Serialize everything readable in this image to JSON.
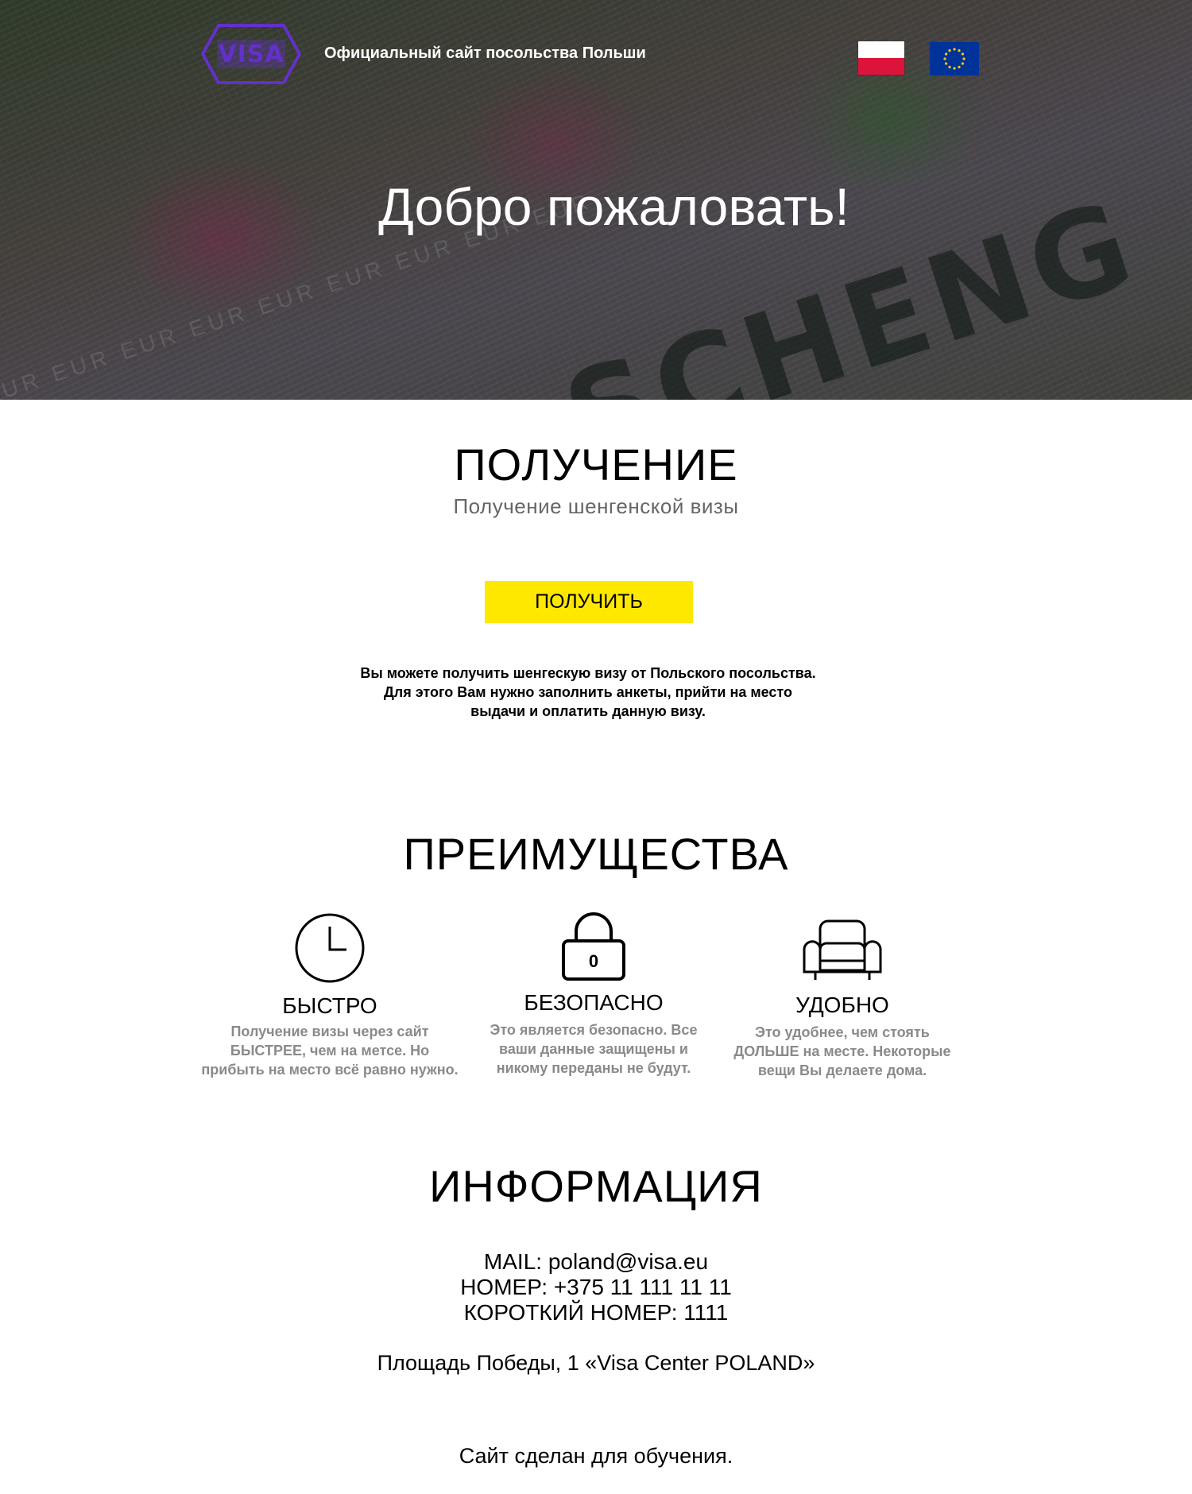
{
  "header": {
    "logo_text": "VISA",
    "site_title": "Официальный сайт посольства Польши",
    "lang_flags": [
      {
        "name": "poland-flag",
        "colors": [
          "#ffffff",
          "#dc143c"
        ]
      },
      {
        "name": "eu-flag",
        "colors": [
          "#003399",
          "#ffcc00"
        ]
      }
    ]
  },
  "hero": {
    "welcome": "Добро пожаловать!",
    "watermark_text": "SCHENG",
    "eur_pattern": "EUR EUR EUR EUR EUR EUR EUR EUR EUR"
  },
  "obtain": {
    "title": "ПОЛУЧЕНИЕ",
    "subtitle": "Получение шенгенской визы",
    "button_label": "ПОЛУЧИТЬ",
    "button_color": "#ffe800",
    "description_lines": [
      "Вы можете получить шенгескую визу от Польского посольства.",
      "Для этого Вам нужно заполнить анкеты, прийти на место",
      "выдачи и оплатить данную визу."
    ]
  },
  "advantages": {
    "title": "ПРЕИМУЩЕСТВА",
    "items": [
      {
        "icon": "clock-icon",
        "title": "БЫСТРО",
        "lines": [
          "Получение визы через сайт",
          "БЫСТРЕЕ, чем на метсе. Но",
          "прибыть на место всё равно нужно."
        ]
      },
      {
        "icon": "lock-icon",
        "icon_text": "0",
        "title": "БЕЗОПАСНО",
        "lines": [
          "Это является безопасно. Все",
          "ваши данные защищены и",
          "никому переданы не будут."
        ]
      },
      {
        "icon": "armchair-icon",
        "title": "УДОБНО",
        "lines": [
          "Это удобнее, чем стоять",
          "ДОЛЬШЕ на месте. Некоторые",
          "вещи Вы делаете дома."
        ]
      }
    ]
  },
  "info": {
    "title": "ИНФОРМАЦИЯ",
    "lines": [
      "MAIL: poland@visa.eu",
      "НОМЕР: +375 11 111 11 11",
      "КОРОТКИЙ НОМЕР: 1111"
    ],
    "address": "Площадь Победы, 1 «Visa Center POLAND»",
    "footer": "Сайт сделан для обучения."
  }
}
